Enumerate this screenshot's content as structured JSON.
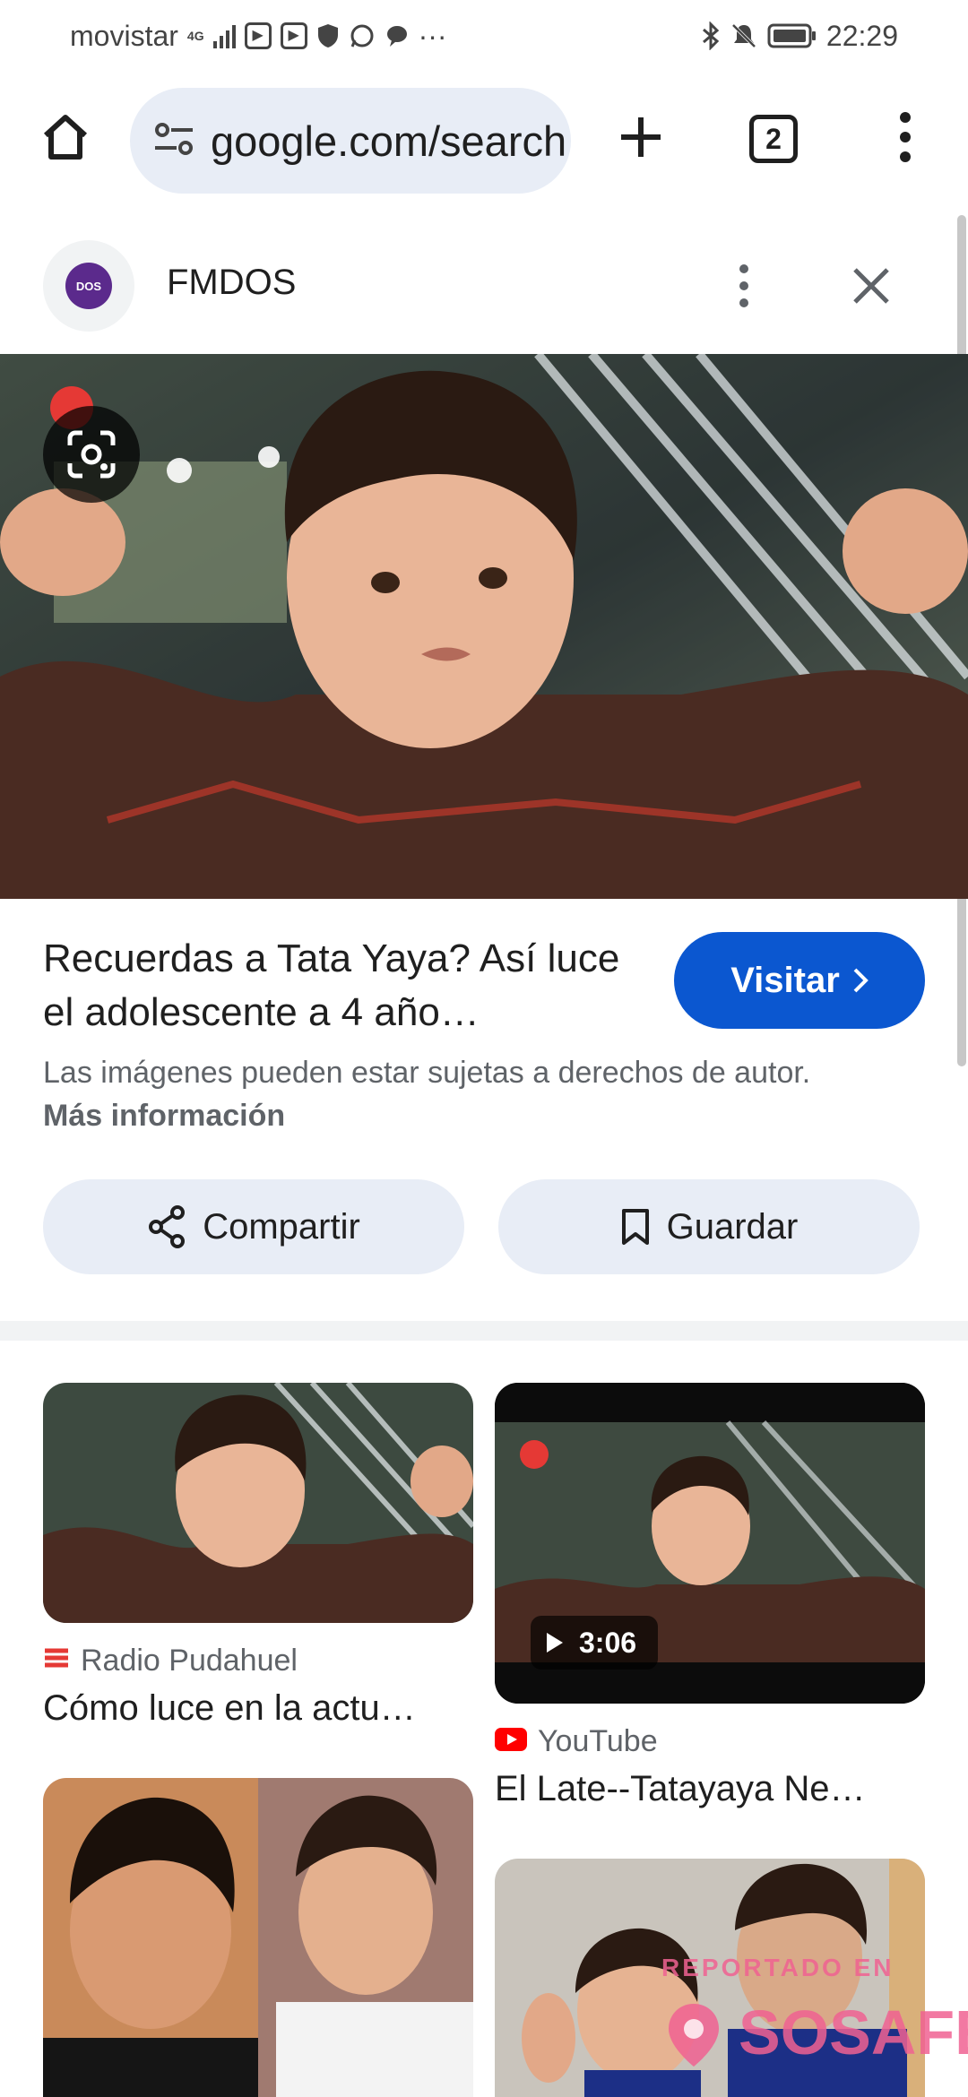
{
  "status_bar": {
    "carrier": "movistar",
    "network": "4G",
    "time": "22:29",
    "more": "···"
  },
  "browser": {
    "url": "google.com/search",
    "tab_count": "2"
  },
  "source": {
    "logo_text": "DOS",
    "name": "FMDOS"
  },
  "result": {
    "title": "Recuerdas a Tata Yaya? Así luce el adolescente a 4 año…",
    "visit_label": "Visitar",
    "copyright_text": "Las imágenes pueden estar sujetas a derechos de autor.",
    "more_info_link": "Más información",
    "share_label": "Compartir",
    "save_label": "Guardar"
  },
  "related": [
    {
      "source": "Radio Pudahuel",
      "title": "Cómo luce en la actu…"
    },
    {
      "source": "YouTube",
      "title": "El Late--Tatayaya Ne…",
      "duration": "3:06"
    }
  ],
  "watermark": {
    "line1": "REPORTADO EN",
    "line2": "SOSAFE"
  },
  "colors": {
    "accent": "#0b57d0",
    "chip_bg": "#e8edf6",
    "youtube": "#ff0000",
    "pudahuel": "#e53935"
  }
}
